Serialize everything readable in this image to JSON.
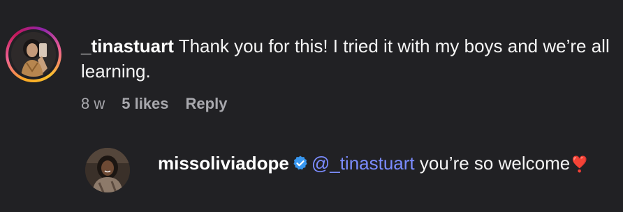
{
  "comment": {
    "username": "_tinastuart",
    "text": "Thank you for this! I tried it with my boys and we’re all learning.",
    "age": "8 w",
    "likes": "5 likes",
    "reply_label": "Reply"
  },
  "reply": {
    "username": "missoliviadope",
    "verified": true,
    "mention": "@_tinastuart",
    "text": "you’re so welcome",
    "emoji": "❣️"
  },
  "colors": {
    "background": "#212124",
    "mention": "#7b8cff",
    "verified_badge": "#3897f0",
    "meta_text": "#a8a8ad"
  },
  "icons": {
    "verified": "verified-badge-icon",
    "heart": "heart-exclamation-emoji"
  }
}
